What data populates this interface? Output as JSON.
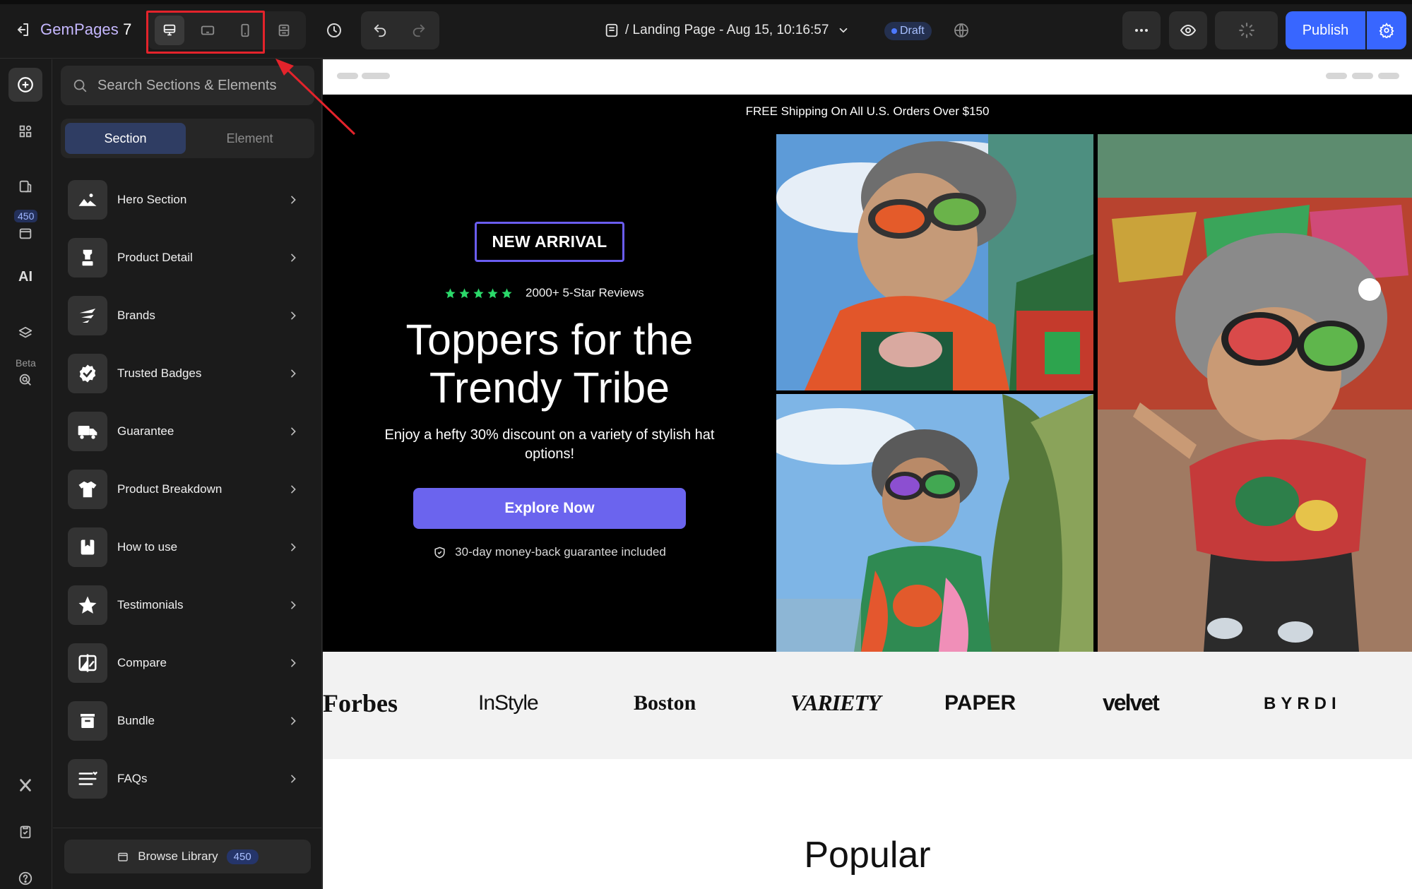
{
  "topbar": {
    "logo_main": "GemPages",
    "logo_version": " 7",
    "page_title": "/ Landing Page - Aug 15, 10:16:57",
    "status": "Draft",
    "publish_label": "Publish"
  },
  "rail": {
    "library_count": "450",
    "beta_label": "Beta",
    "ai_label": "AI"
  },
  "panel": {
    "search_placeholder": "Search Sections & Elements",
    "tabs": [
      "Section",
      "Element"
    ],
    "items": [
      {
        "label": "Hero Section",
        "icon": "image-icon"
      },
      {
        "label": "Product Detail",
        "icon": "product-icon"
      },
      {
        "label": "Brands",
        "icon": "brand-icon"
      },
      {
        "label": "Trusted Badges",
        "icon": "badge-check-icon"
      },
      {
        "label": "Guarantee",
        "icon": "truck-icon"
      },
      {
        "label": "Product Breakdown",
        "icon": "tshirt-icon"
      },
      {
        "label": "How to use",
        "icon": "bookmark-icon"
      },
      {
        "label": "Testimonials",
        "icon": "star-icon"
      },
      {
        "label": "Compare",
        "icon": "compare-icon"
      },
      {
        "label": "Bundle",
        "icon": "bundle-icon"
      },
      {
        "label": "FAQs",
        "icon": "faq-icon"
      }
    ],
    "browse_label": "Browse Library",
    "browse_count": "450"
  },
  "canvas": {
    "shipping_text": "FREE Shipping On All U.S. Orders Over $150",
    "badge": "NEW ARRIVAL",
    "reviews": "2000+ 5-Star Reviews",
    "headline_line1": "Toppers for the",
    "headline_line2": "Trendy Tribe",
    "subtext": "Enjoy a hefty 30% discount on a variety of stylish hat options!",
    "cta": "Explore Now",
    "guarantee": "30-day money-back guarantee included",
    "brands": [
      "Forbes",
      "InStyle",
      "Boston",
      "VARIETY",
      "PAPER",
      "velvet",
      "BYRDI"
    ],
    "section_title": "Popular"
  },
  "colors": {
    "accent": "#3866ff",
    "cta": "#6b64ee",
    "star": "#2bd96a",
    "highlight": "#e3232b"
  }
}
